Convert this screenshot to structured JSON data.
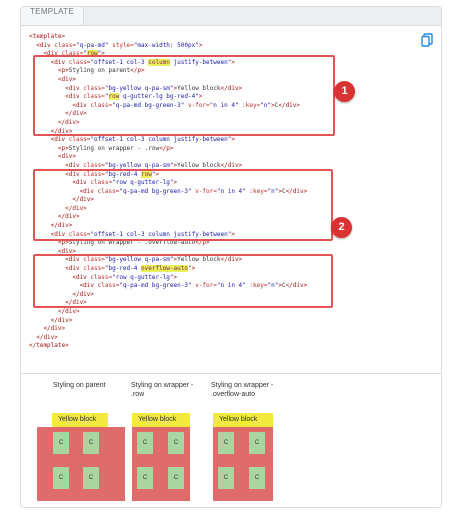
{
  "tab": {
    "label": "TEMPLATE"
  },
  "code_lines": [
    [
      [
        "tag",
        "<template>"
      ]
    ],
    [
      [
        "tag",
        "  <div "
      ],
      [
        "attr",
        "class="
      ],
      [
        "str",
        "\"q-pa-md\""
      ],
      [
        "attr",
        " style="
      ],
      [
        "str",
        "\"max-width: 500px\""
      ],
      [
        "tag",
        ">"
      ]
    ],
    [
      [
        "tag",
        "    <div "
      ],
      [
        "attr",
        "class="
      ],
      [
        "str",
        "\""
      ],
      [
        "hl",
        "row"
      ],
      [
        "str",
        "\""
      ],
      [
        "tag",
        ">"
      ]
    ],
    [
      [
        "tag",
        "      <div "
      ],
      [
        "attr",
        "class="
      ],
      [
        "str",
        "\"offset-1 col-3 "
      ],
      [
        "hl",
        "column"
      ],
      [
        "str",
        " justify-between\""
      ],
      [
        "tag",
        ">"
      ]
    ],
    [
      [
        "tag",
        "        <p>"
      ],
      [
        "txt",
        "Styling on parent"
      ],
      [
        "tag",
        "</p>"
      ]
    ],
    [
      [
        "tag",
        "        <div>"
      ]
    ],
    [
      [
        "tag",
        "          <div "
      ],
      [
        "attr",
        "class="
      ],
      [
        "str",
        "\"bg-yellow q-pa-sm\""
      ],
      [
        "tag",
        ">"
      ],
      [
        "txt",
        "Yellow block"
      ],
      [
        "tag",
        "</div>"
      ]
    ],
    [
      [
        "tag",
        "          <div "
      ],
      [
        "attr",
        "class="
      ],
      [
        "str",
        "\""
      ],
      [
        "hl",
        "row"
      ],
      [
        "str",
        " q-gutter-lg bg-red-4\""
      ],
      [
        "tag",
        ">"
      ]
    ],
    [
      [
        "tag",
        "            <div "
      ],
      [
        "attr",
        "class="
      ],
      [
        "str",
        "\"q-pa-md bg-green-3\""
      ],
      [
        "attr",
        " v-for="
      ],
      [
        "str",
        "\"n in 4\""
      ],
      [
        "attr",
        " :key="
      ],
      [
        "str",
        "\"n\""
      ],
      [
        "tag",
        ">"
      ],
      [
        "txt",
        "C"
      ],
      [
        "tag",
        "</div>"
      ]
    ],
    [
      [
        "tag",
        "          </div>"
      ]
    ],
    [
      [
        "tag",
        "        </div>"
      ]
    ],
    [
      [
        "tag",
        "      </div>"
      ]
    ],
    [
      [
        "tag",
        "      <div "
      ],
      [
        "attr",
        "class="
      ],
      [
        "str",
        "\"offset-1 col-3 column justify-between\""
      ],
      [
        "tag",
        ">"
      ]
    ],
    [
      [
        "tag",
        "        <p>"
      ],
      [
        "txt",
        "Styling on wrapper - .row"
      ],
      [
        "tag",
        "</p>"
      ]
    ],
    [
      [
        "tag",
        "        <div>"
      ]
    ],
    [
      [
        "tag",
        "          <div "
      ],
      [
        "attr",
        "class="
      ],
      [
        "str",
        "\"bg-yellow q-pa-sm\""
      ],
      [
        "tag",
        ">"
      ],
      [
        "txt",
        "Yellow block"
      ],
      [
        "tag",
        "</div>"
      ]
    ],
    [
      [
        "tag",
        "          <div "
      ],
      [
        "attr",
        "class="
      ],
      [
        "str",
        "\"bg-red-4 "
      ],
      [
        "hl",
        "row"
      ],
      [
        "str",
        "\""
      ],
      [
        "tag",
        ">"
      ]
    ],
    [
      [
        "tag",
        "            <div "
      ],
      [
        "attr",
        "class="
      ],
      [
        "str",
        "\"row q-gutter-lg\""
      ],
      [
        "tag",
        ">"
      ]
    ],
    [
      [
        "tag",
        "              <div "
      ],
      [
        "attr",
        "class="
      ],
      [
        "str",
        "\"q-pa-md bg-green-3\""
      ],
      [
        "attr",
        " v-for="
      ],
      [
        "str",
        "\"n in 4\""
      ],
      [
        "attr",
        " :key="
      ],
      [
        "str",
        "\"n\""
      ],
      [
        "tag",
        ">"
      ],
      [
        "txt",
        "C"
      ],
      [
        "tag",
        "</div>"
      ]
    ],
    [
      [
        "tag",
        "            </div>"
      ]
    ],
    [
      [
        "tag",
        "          </div>"
      ]
    ],
    [
      [
        "tag",
        "        </div>"
      ]
    ],
    [
      [
        "tag",
        "      </div>"
      ]
    ],
    [
      [
        "tag",
        "      <div "
      ],
      [
        "attr",
        "class="
      ],
      [
        "str",
        "\"offset-1 col-3 column justify-between\""
      ],
      [
        "tag",
        ">"
      ]
    ],
    [
      [
        "tag",
        "        <p>"
      ],
      [
        "txt",
        "Styling on wrapper - .overflow-auto"
      ],
      [
        "tag",
        "</p>"
      ]
    ],
    [
      [
        "tag",
        "        <div>"
      ]
    ],
    [
      [
        "tag",
        "          <div "
      ],
      [
        "attr",
        "class="
      ],
      [
        "str",
        "\"bg-yellow q-pa-sm\""
      ],
      [
        "tag",
        ">"
      ],
      [
        "txt",
        "Yellow block"
      ],
      [
        "tag",
        "</div>"
      ]
    ],
    [
      [
        "tag",
        "          <div "
      ],
      [
        "attr",
        "class="
      ],
      [
        "str",
        "\"bg-red-4 "
      ],
      [
        "hl",
        "overflow-auto"
      ],
      [
        "str",
        "\""
      ],
      [
        "tag",
        ">"
      ]
    ],
    [
      [
        "tag",
        "            <div "
      ],
      [
        "attr",
        "class="
      ],
      [
        "str",
        "\"row q-gutter-lg\""
      ],
      [
        "tag",
        ">"
      ]
    ],
    [
      [
        "tag",
        "              <div "
      ],
      [
        "attr",
        "class="
      ],
      [
        "str",
        "\"q-pa-md bg-green-3\""
      ],
      [
        "attr",
        " v-for="
      ],
      [
        "str",
        "\"n in 4\""
      ],
      [
        "attr",
        " :key="
      ],
      [
        "str",
        "\"n\""
      ],
      [
        "tag",
        ">"
      ],
      [
        "txt",
        "C"
      ],
      [
        "tag",
        "</div>"
      ]
    ],
    [
      [
        "tag",
        "            </div>"
      ]
    ],
    [
      [
        "tag",
        "          </div>"
      ]
    ],
    [
      [
        "tag",
        "        </div>"
      ]
    ],
    [
      [
        "tag",
        "      </div>"
      ]
    ],
    [
      [
        "tag",
        "    </div>"
      ]
    ],
    [
      [
        "tag",
        "  </div>"
      ]
    ],
    [
      [
        "tag",
        "</template>"
      ]
    ]
  ],
  "annotations": {
    "badge1": "1",
    "badge2": "2"
  },
  "demos": [
    {
      "caption": "Styling on parent",
      "yellow": "Yellow block",
      "cell": "C"
    },
    {
      "caption": "Styling on wrapper - .row",
      "yellow": "Yellow block",
      "cell": "C"
    },
    {
      "caption": "Styling on wrapper - .overflow-auto",
      "yellow": "Yellow block",
      "cell": "C"
    }
  ],
  "icons": {
    "copy": "copy-icon"
  },
  "colors": {
    "yellow": "#f2ea3f",
    "red": "#e06b6b",
    "green": "#a8d5a0",
    "annotation": "#d93232"
  }
}
